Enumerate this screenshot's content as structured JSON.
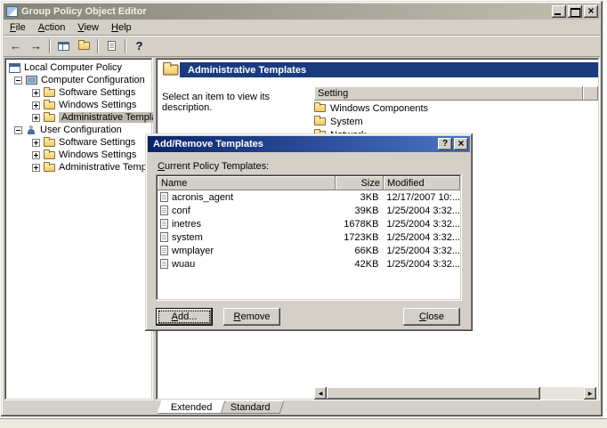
{
  "window": {
    "title": "Group Policy Object Editor"
  },
  "menu": {
    "items": [
      {
        "label": "File"
      },
      {
        "label": "Action"
      },
      {
        "label": "View"
      },
      {
        "label": "Help"
      }
    ]
  },
  "tree": {
    "items": [
      {
        "label": "Local Computer Policy"
      },
      {
        "label": "Computer Configuration"
      },
      {
        "label": "Software Settings"
      },
      {
        "label": "Windows Settings"
      },
      {
        "label": "Administrative Templates"
      },
      {
        "label": "User Configuration"
      },
      {
        "label": "Software Settings"
      },
      {
        "label": "Windows Settings"
      },
      {
        "label": "Administrative Templates"
      }
    ]
  },
  "content": {
    "header_title": "Administrative Templates",
    "description": "Select an item to view its description.",
    "column_header": "Setting",
    "items": [
      {
        "label": "Windows Components"
      },
      {
        "label": "System"
      },
      {
        "label": "Network"
      }
    ]
  },
  "tabs": {
    "extended": "Extended",
    "standard": "Standard"
  },
  "dialog": {
    "title": "Add/Remove Templates",
    "label": "Current Policy Templates:",
    "columns": {
      "name": "Name",
      "size": "Size",
      "modified": "Modified"
    },
    "rows": [
      {
        "name": "acronis_agent",
        "size": "3KB",
        "modified": "12/17/2007 10:..."
      },
      {
        "name": "conf",
        "size": "39KB",
        "modified": "1/25/2004 3:32..."
      },
      {
        "name": "inetres",
        "size": "1678KB",
        "modified": "1/25/2004 3:32..."
      },
      {
        "name": "system",
        "size": "1723KB",
        "modified": "1/25/2004 3:32..."
      },
      {
        "name": "wmplayer",
        "size": "66KB",
        "modified": "1/25/2004 3:32..."
      },
      {
        "name": "wuau",
        "size": "42KB",
        "modified": "1/25/2004 3:32..."
      }
    ],
    "buttons": {
      "add": "Add...",
      "remove": "Remove",
      "close": "Close"
    }
  },
  "colors": {
    "chrome": "#d4d0c8",
    "titlebar_active_start": "#0a246a",
    "titlebar_active_end": "#4a74c4",
    "titlebar_inactive_start": "#87857a",
    "titlebar_inactive_end": "#c2bfb2",
    "header_band": "#1a3b7e",
    "selection_inactive": "#bdbab1",
    "folder": "#ffe9a6"
  }
}
